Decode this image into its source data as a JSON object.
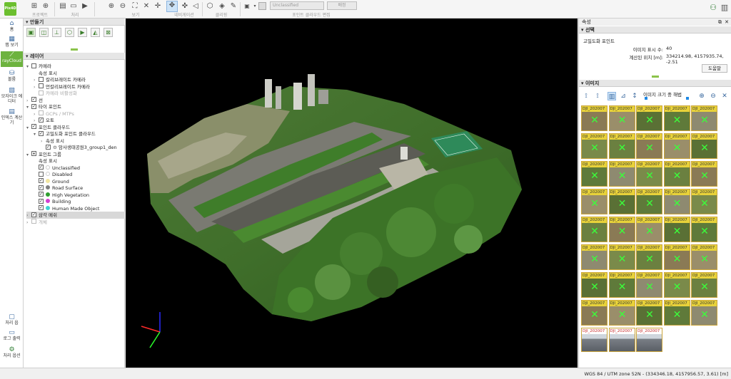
{
  "toolbar": {
    "groups": [
      "프로젝트",
      "처리",
      "보기",
      "네비게이션",
      "클리핑",
      "포인트 클라우드 편집"
    ],
    "class_select": "Unclassified",
    "assign_button": "배정",
    "logo_text": "Pix4D"
  },
  "rail": {
    "items": [
      {
        "label": "홈",
        "icon": "home-icon"
      },
      {
        "label": "맵 보기",
        "icon": "map-icon"
      },
      {
        "label": "rayCloud",
        "icon": "raycloud-icon"
      },
      {
        "label": "볼륨",
        "icon": "volume-icon"
      },
      {
        "label": "모자이크 에디터",
        "icon": "mosaic-icon"
      },
      {
        "label": "인덱스 계산기",
        "icon": "index-icon"
      }
    ],
    "bottom": [
      {
        "label": "처리 옵",
        "icon": "process-icon"
      },
      {
        "label": "로그 출력",
        "icon": "log-icon"
      },
      {
        "label": "처리 옵션",
        "icon": "gear-icon"
      }
    ]
  },
  "left": {
    "create_title": "만들기",
    "layers_title": "레이어",
    "tree": [
      {
        "label": "카메라",
        "indent": 0,
        "arrow": "v",
        "check": "none"
      },
      {
        "label": "속성 표시",
        "indent": 1,
        "arrow": "",
        "check": null
      },
      {
        "label": "칼리브레이트 카메라",
        "indent": 1,
        "arrow": ">",
        "check": "none"
      },
      {
        "label": "언칼리브레이트 카메라",
        "indent": 1,
        "arrow": ">",
        "check": "none"
      },
      {
        "label": "카메라 비활성화",
        "indent": 1,
        "arrow": "",
        "check": "disabled",
        "grey": true
      },
      {
        "label": "선",
        "indent": 0,
        "arrow": ">",
        "check": "checked"
      },
      {
        "label": "타이 포인트",
        "indent": 0,
        "arrow": "v",
        "check": "checked"
      },
      {
        "label": "GCPs / MTPs",
        "indent": 1,
        "arrow": ">",
        "check": "disabled",
        "grey": true
      },
      {
        "label": "오토",
        "indent": 1,
        "arrow": ">",
        "check": "checked"
      },
      {
        "label": "포인트 클라우드",
        "indent": 0,
        "arrow": "v",
        "check": "checked"
      },
      {
        "label": "고밀도화 포인트 클라우드",
        "indent": 1,
        "arrow": "v",
        "check": "checked"
      },
      {
        "label": "속성 표시",
        "indent": 2,
        "arrow": ">",
        "check": null
      },
      {
        "label": "암사생태공원3_group1_den",
        "indent": 2,
        "arrow": "",
        "check": "checked",
        "icon": true
      },
      {
        "label": "포인트 그룹",
        "indent": 0,
        "arrow": "v",
        "check": "partial"
      },
      {
        "label": "속성 표시",
        "indent": 1,
        "arrow": "",
        "check": null
      },
      {
        "label": "Unclassified",
        "indent": 1,
        "arrow": "",
        "check": "checked",
        "color": "#ffffff"
      },
      {
        "label": "Disabled",
        "indent": 1,
        "arrow": "",
        "check": "none",
        "color": "#ffffff"
      },
      {
        "label": "Ground",
        "indent": 1,
        "arrow": "",
        "check": "checked",
        "color": "#f2e6a0"
      },
      {
        "label": "Road Surface",
        "indent": 1,
        "arrow": "",
        "check": "checked",
        "color": "#808080"
      },
      {
        "label": "High Vegetation",
        "indent": 1,
        "arrow": "",
        "check": "checked",
        "color": "#2e9e2e"
      },
      {
        "label": "Building",
        "indent": 1,
        "arrow": "",
        "check": "checked",
        "color": "#d33fd3"
      },
      {
        "label": "Human Made Object",
        "indent": 1,
        "arrow": "",
        "check": "checked",
        "color": "#3fd3d3"
      },
      {
        "label": "삼각 메쉬",
        "indent": 0,
        "arrow": ">",
        "check": "checked",
        "highlight": true
      },
      {
        "label": "개체",
        "indent": 0,
        "arrow": ">",
        "check": "disabled",
        "grey": true
      }
    ]
  },
  "right": {
    "title": "속성",
    "selection_title": "선택",
    "point_type": "고밀도화 포인트",
    "image_count_label": "이미지 표시 수:",
    "image_count": "40",
    "computed_pos_label": "계산된 위치 [m]:",
    "computed_pos": "334214.98, 4157935.74, -2.51",
    "help_button": "도움말",
    "images_title": "이미지",
    "image_size_label": "이미지 크기 중 해법",
    "thumb_label": "DJI_202007",
    "thumb_count": 40,
    "city_thumbs": 3
  },
  "status": {
    "text": "WGS 84 / UTM zone 52N - (334346.18, 4157956.57, 3.61) [m]"
  },
  "colors": {
    "accent": "#6db33f",
    "view_bg": "#000000",
    "thumb_label_bg": "#e8d23a"
  }
}
